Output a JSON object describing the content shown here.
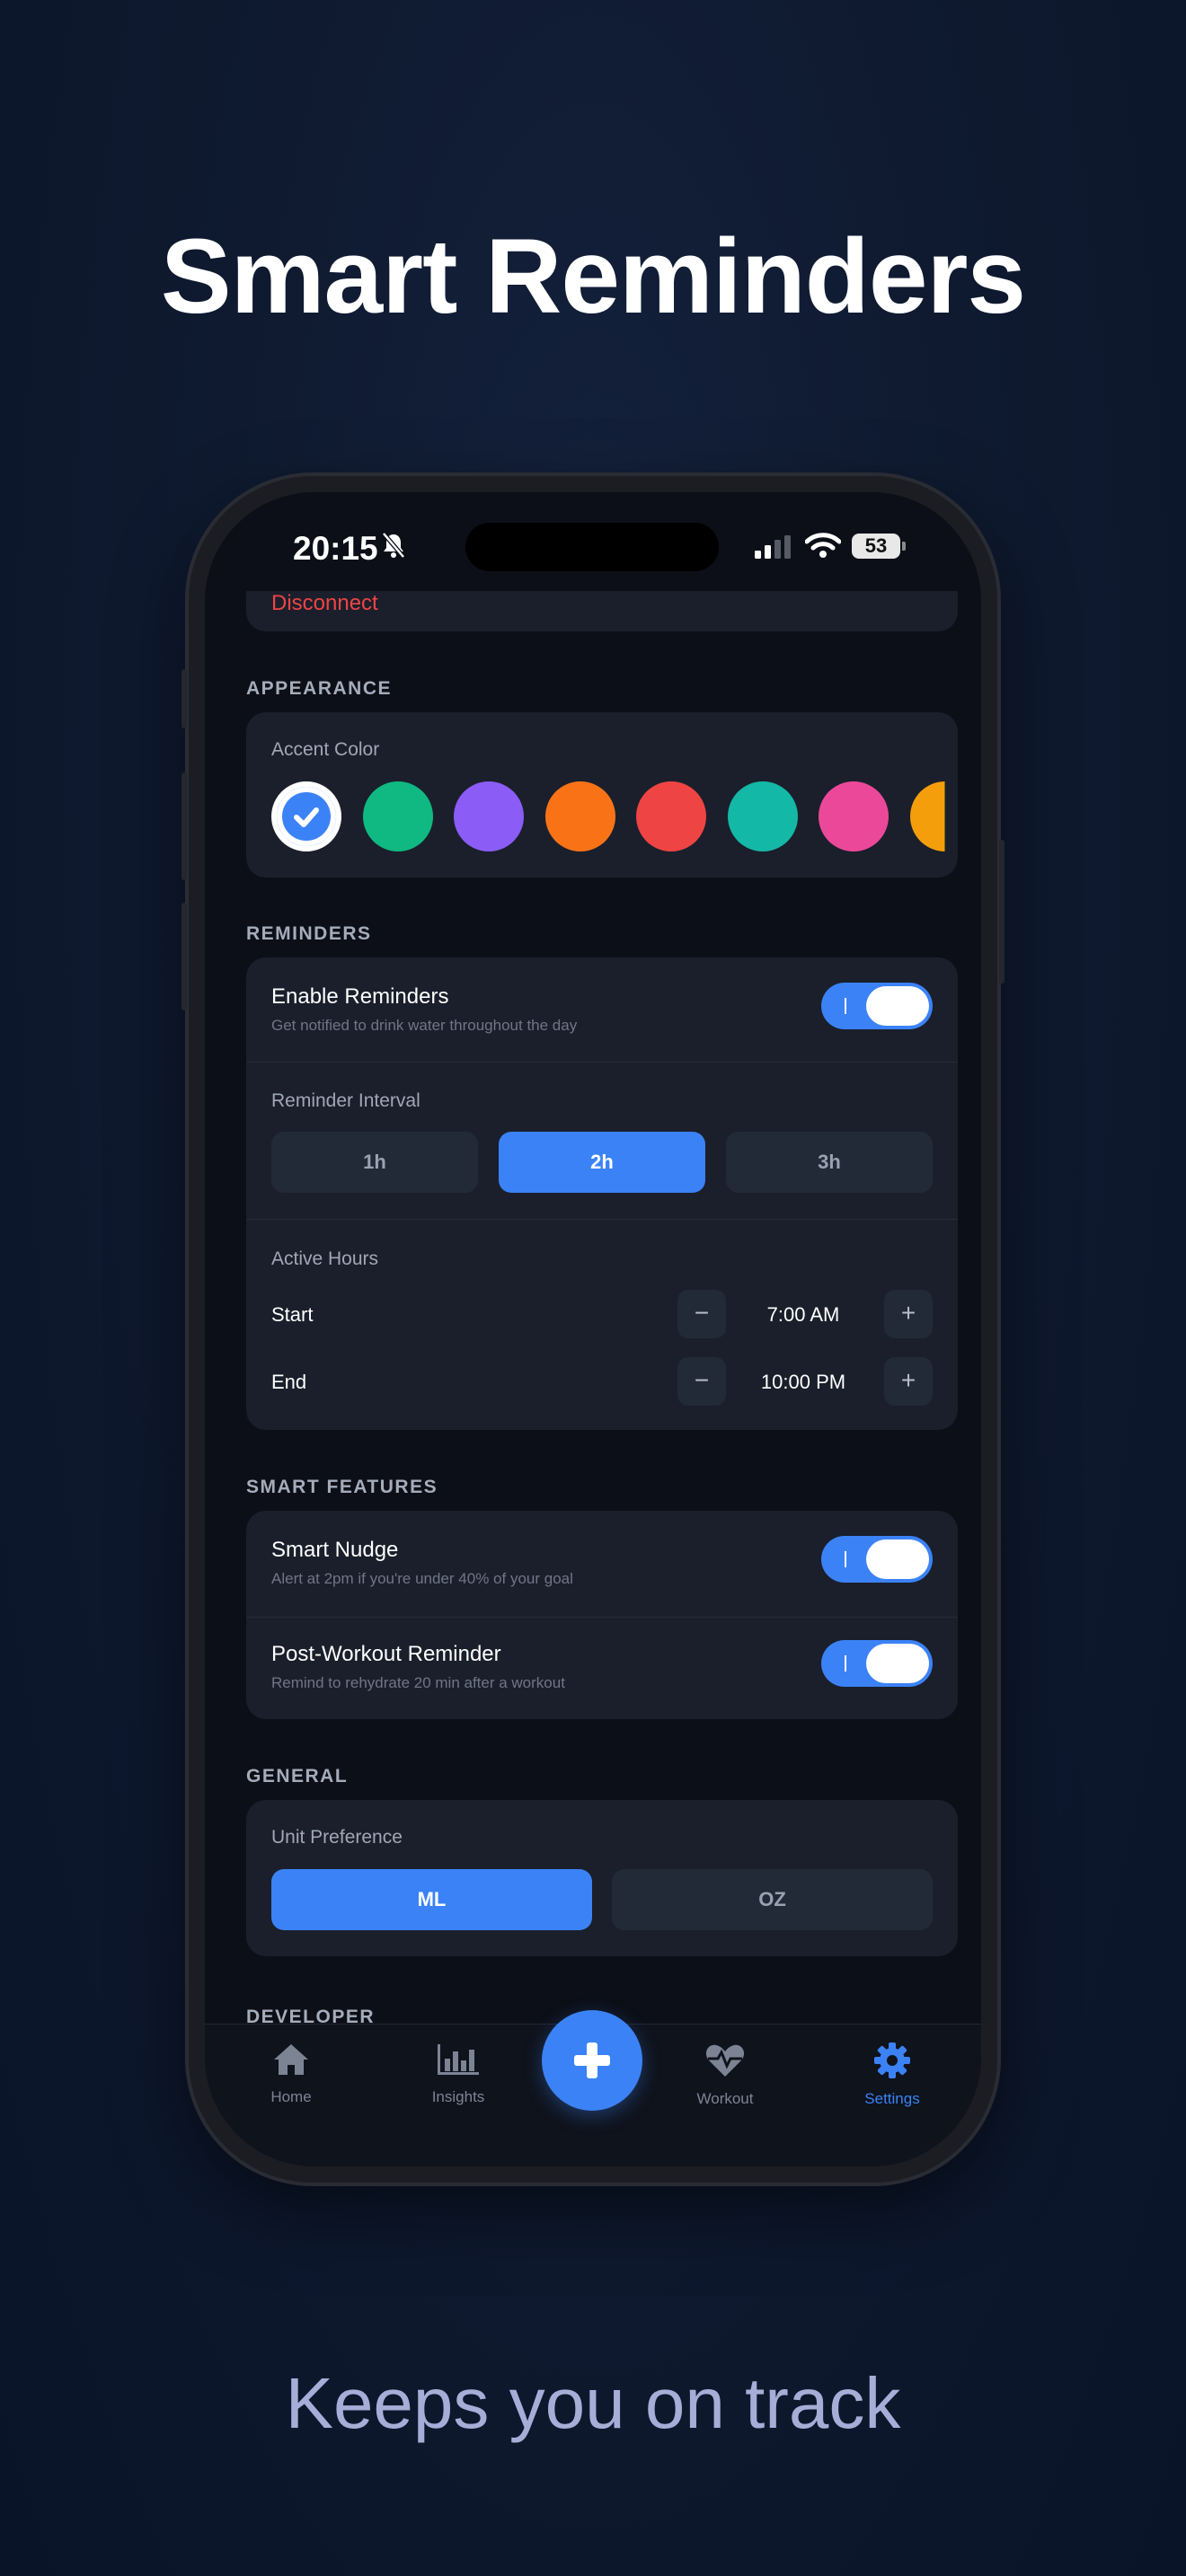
{
  "headline": "Smart Reminders",
  "subline": "Keeps you on track",
  "status_bar": {
    "time": "20:15",
    "battery": "53"
  },
  "account": {
    "disconnect_label": "Disconnect"
  },
  "appearance": {
    "section_label": "APPEARANCE",
    "accent_label": "Accent Color",
    "colors": [
      "#3b82f6",
      "#10b981",
      "#8b5cf6",
      "#f97316",
      "#ef4444",
      "#14b8a6",
      "#ec4899",
      "#f59e0b"
    ],
    "selected_index": 0
  },
  "reminders": {
    "section_label": "REMINDERS",
    "enable_title": "Enable Reminders",
    "enable_desc": "Get notified to drink water throughout the day",
    "enable_on": true,
    "interval_label": "Reminder Interval",
    "intervals": [
      "1h",
      "2h",
      "3h"
    ],
    "interval_selected": "2h",
    "active_hours_label": "Active Hours",
    "start_label": "Start",
    "start_value": "7:00 AM",
    "end_label": "End",
    "end_value": "10:00 PM",
    "minus": "−",
    "plus": "+"
  },
  "smart_features": {
    "section_label": "SMART FEATURES",
    "nudge_title": "Smart Nudge",
    "nudge_desc": "Alert at 2pm if you're under 40% of your goal",
    "nudge_on": true,
    "post_title": "Post-Workout Reminder",
    "post_desc": "Remind to rehydrate 20 min after a workout",
    "post_on": true
  },
  "general": {
    "section_label": "GENERAL",
    "unit_label": "Unit Preference",
    "units": [
      "ML",
      "OZ"
    ],
    "unit_selected": "ML"
  },
  "developer": {
    "section_label": "DEVELOPER"
  },
  "tabbar": {
    "home": "Home",
    "insights": "Insights",
    "workout": "Workout",
    "settings": "Settings",
    "active": "Settings"
  }
}
